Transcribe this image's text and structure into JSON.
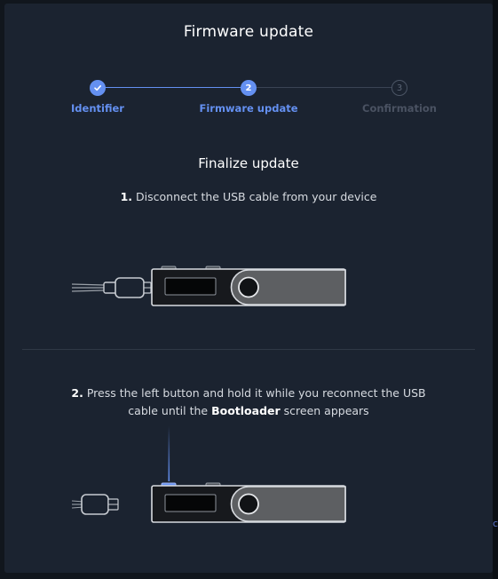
{
  "modal": {
    "title": "Firmware update"
  },
  "stepper": {
    "steps": [
      {
        "label": "Identifier",
        "number": "1",
        "state": "done",
        "icon": "check-icon"
      },
      {
        "label": "Firmware update",
        "number": "2",
        "state": "active"
      },
      {
        "label": "Confirmation",
        "number": "3",
        "state": "pending"
      }
    ]
  },
  "content": {
    "subtitle": "Finalize update",
    "step1": {
      "number": "1.",
      "text": "Disconnect the USB cable from your device"
    },
    "step2": {
      "number": "2.",
      "text_before": "Press the left button and hold it while you reconnect the USB cable until the",
      "emphasis": "Bootloader",
      "text_after": "screen appears"
    }
  },
  "colors": {
    "accent": "#6490f1",
    "modal_bg": "#1b2330",
    "inactive": "#4a5262"
  }
}
